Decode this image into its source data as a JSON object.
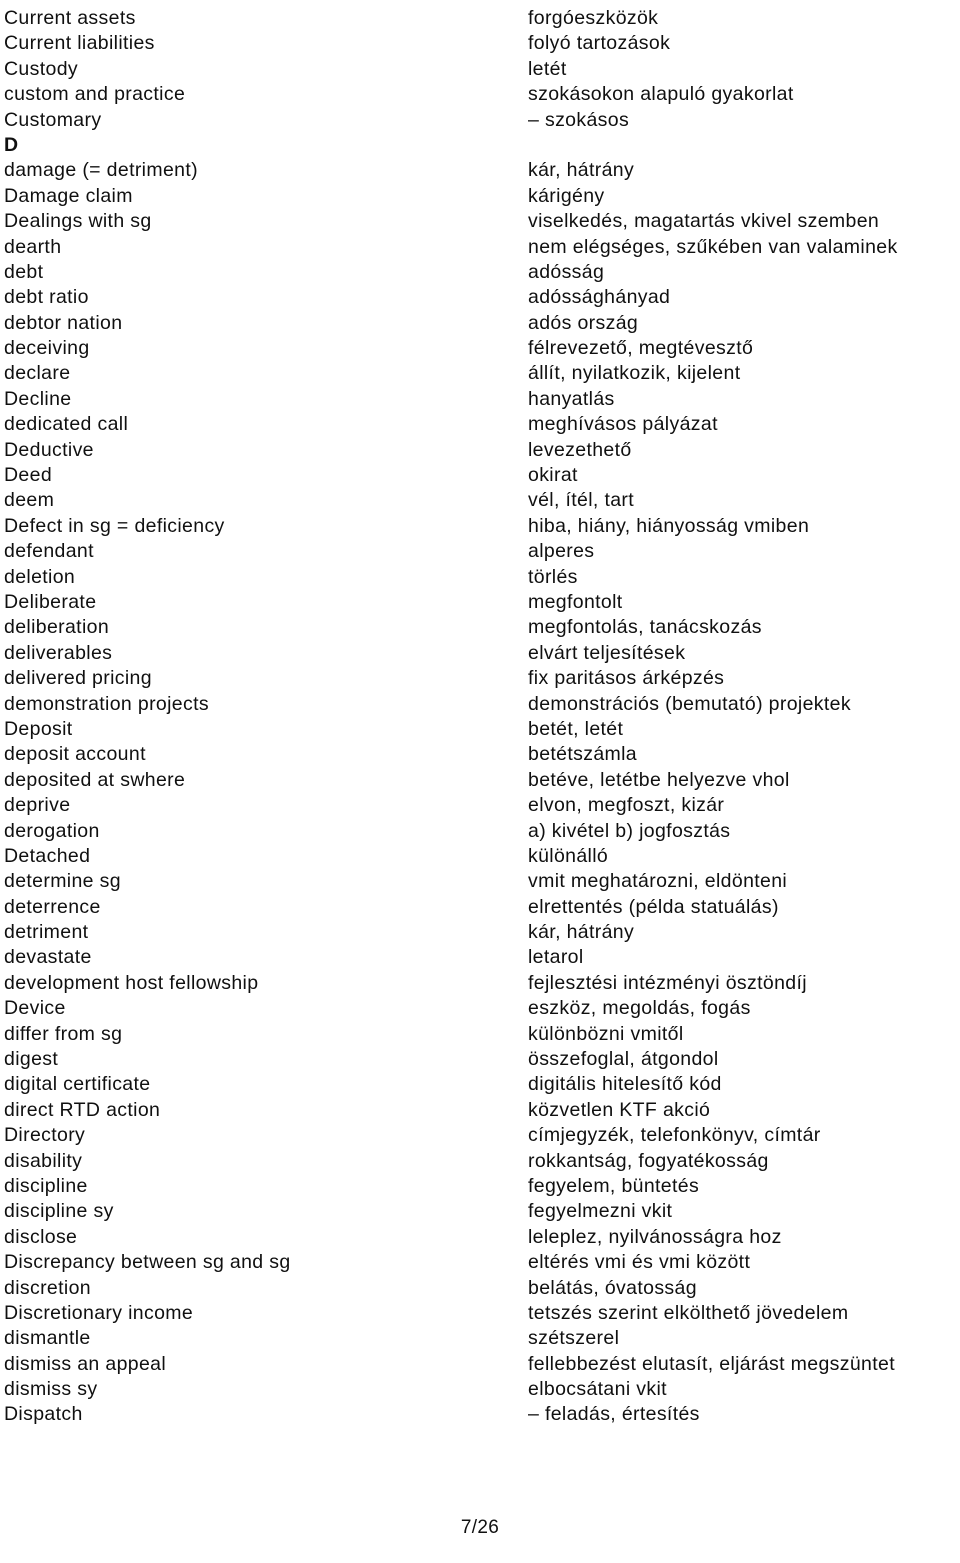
{
  "document": {
    "type": "glossary",
    "page_number": "7/26"
  },
  "entries": [
    {
      "term": "Current assets",
      "definition": "forgóeszközök",
      "section": false
    },
    {
      "term": "Current liabilities",
      "definition": "folyó tartozások",
      "section": false
    },
    {
      "term": "Custody",
      "definition": "letét",
      "section": false
    },
    {
      "term": "custom and practice",
      "definition": "szokásokon alapuló gyakorlat",
      "section": false
    },
    {
      "term": "Customary",
      "definition": "– szokásos",
      "section": false
    },
    {
      "term": "D",
      "definition": "",
      "section": true
    },
    {
      "term": "damage (= detriment)",
      "definition": "kár, hátrány",
      "section": false
    },
    {
      "term": "Damage claim",
      "definition": "kárigény",
      "section": false
    },
    {
      "term": "Dealings with sg",
      "definition": "viselkedés, magatartás vkivel szemben",
      "section": false
    },
    {
      "term": "dearth",
      "definition": "nem elégséges, szűkében van valaminek",
      "section": false
    },
    {
      "term": "debt",
      "definition": "adósság",
      "section": false
    },
    {
      "term": "debt ratio",
      "definition": "adóssághányad",
      "section": false
    },
    {
      "term": "debtor nation",
      "definition": "adós ország",
      "section": false
    },
    {
      "term": "deceiving",
      "definition": "félrevezető, megtévesztő",
      "section": false
    },
    {
      "term": "declare",
      "definition": "állít, nyilatkozik, kijelent",
      "section": false
    },
    {
      "term": "Decline",
      "definition": "hanyatlás",
      "section": false
    },
    {
      "term": "dedicated call",
      "definition": "meghívásos pályázat",
      "section": false
    },
    {
      "term": "Deductive",
      "definition": "levezethető",
      "section": false
    },
    {
      "term": "Deed",
      "definition": "okirat",
      "section": false
    },
    {
      "term": "deem",
      "definition": "vél, ítél, tart",
      "section": false
    },
    {
      "term": "Defect in sg = deficiency",
      "definition": "hiba, hiány, hiányosság vmiben",
      "section": false
    },
    {
      "term": "defendant",
      "definition": "alperes",
      "section": false
    },
    {
      "term": "deletion",
      "definition": "törlés",
      "section": false
    },
    {
      "term": "Deliberate",
      "definition": "megfontolt",
      "section": false
    },
    {
      "term": "deliberation",
      "definition": "megfontolás, tanácskozás",
      "section": false
    },
    {
      "term": "deliverables",
      "definition": "elvárt teljesítések",
      "section": false
    },
    {
      "term": "delivered pricing",
      "definition": "fix paritásos árképzés",
      "section": false
    },
    {
      "term": "demonstration projects",
      "definition": "demonstrációs (bemutató) projektek",
      "section": false
    },
    {
      "term": "Deposit",
      "definition": "betét, letét",
      "section": false
    },
    {
      "term": "deposit account",
      "definition": "betétszámla",
      "section": false
    },
    {
      "term": "deposited at swhere",
      "definition": "betéve, letétbe helyezve vhol",
      "section": false
    },
    {
      "term": "deprive",
      "definition": "elvon, megfoszt, kizár",
      "section": false
    },
    {
      "term": "derogation",
      "definition": "a) kivétel b) jogfosztás",
      "section": false
    },
    {
      "term": "Detached",
      "definition": "különálló",
      "section": false
    },
    {
      "term": "determine sg",
      "definition": "vmit meghatározni, eldönteni",
      "section": false
    },
    {
      "term": "deterrence",
      "definition": "elrettentés (példa statuálás)",
      "section": false
    },
    {
      "term": "detriment",
      "definition": "kár, hátrány",
      "section": false
    },
    {
      "term": "devastate",
      "definition": "letarol",
      "section": false
    },
    {
      "term": "development host fellowship",
      "definition": "fejlesztési intézményi ösztöndíj",
      "section": false
    },
    {
      "term": "Device",
      "definition": "eszköz, megoldás, fogás",
      "section": false
    },
    {
      "term": "differ from sg",
      "definition": "különbözni vmitől",
      "section": false
    },
    {
      "term": "digest",
      "definition": "összefoglal, átgondol",
      "section": false
    },
    {
      "term": "digital certificate",
      "definition": "digitális hitelesítő kód",
      "section": false
    },
    {
      "term": "direct RTD action",
      "definition": "közvetlen KTF akció",
      "section": false
    },
    {
      "term": "Directory",
      "definition": "címjegyzék, telefonkönyv, címtár",
      "section": false
    },
    {
      "term": "disability",
      "definition": "rokkantság, fogyatékosság",
      "section": false
    },
    {
      "term": "discipline",
      "definition": "fegyelem, büntetés",
      "section": false
    },
    {
      "term": "discipline sy",
      "definition": "fegyelmezni vkit",
      "section": false
    },
    {
      "term": "disclose",
      "definition": "leleplez, nyilvánosságra hoz",
      "section": false
    },
    {
      "term": "Discrepancy between sg and sg",
      "definition": "eltérés vmi és vmi között",
      "section": false
    },
    {
      "term": "discretion",
      "definition": "belátás, óvatosság",
      "section": false
    },
    {
      "term": "Discretionary income",
      "definition": "tetszés szerint elkölthető jövedelem",
      "section": false
    },
    {
      "term": "dismantle",
      "definition": "szétszerel",
      "section": false
    },
    {
      "term": "dismiss an appeal",
      "definition": "fellebbezést elutasít, eljárást megszüntet",
      "section": false
    },
    {
      "term": "dismiss sy",
      "definition": "elbocsátani vkit",
      "section": false
    },
    {
      "term": "Dispatch",
      "definition": "– feladás, értesítés",
      "section": false
    }
  ]
}
